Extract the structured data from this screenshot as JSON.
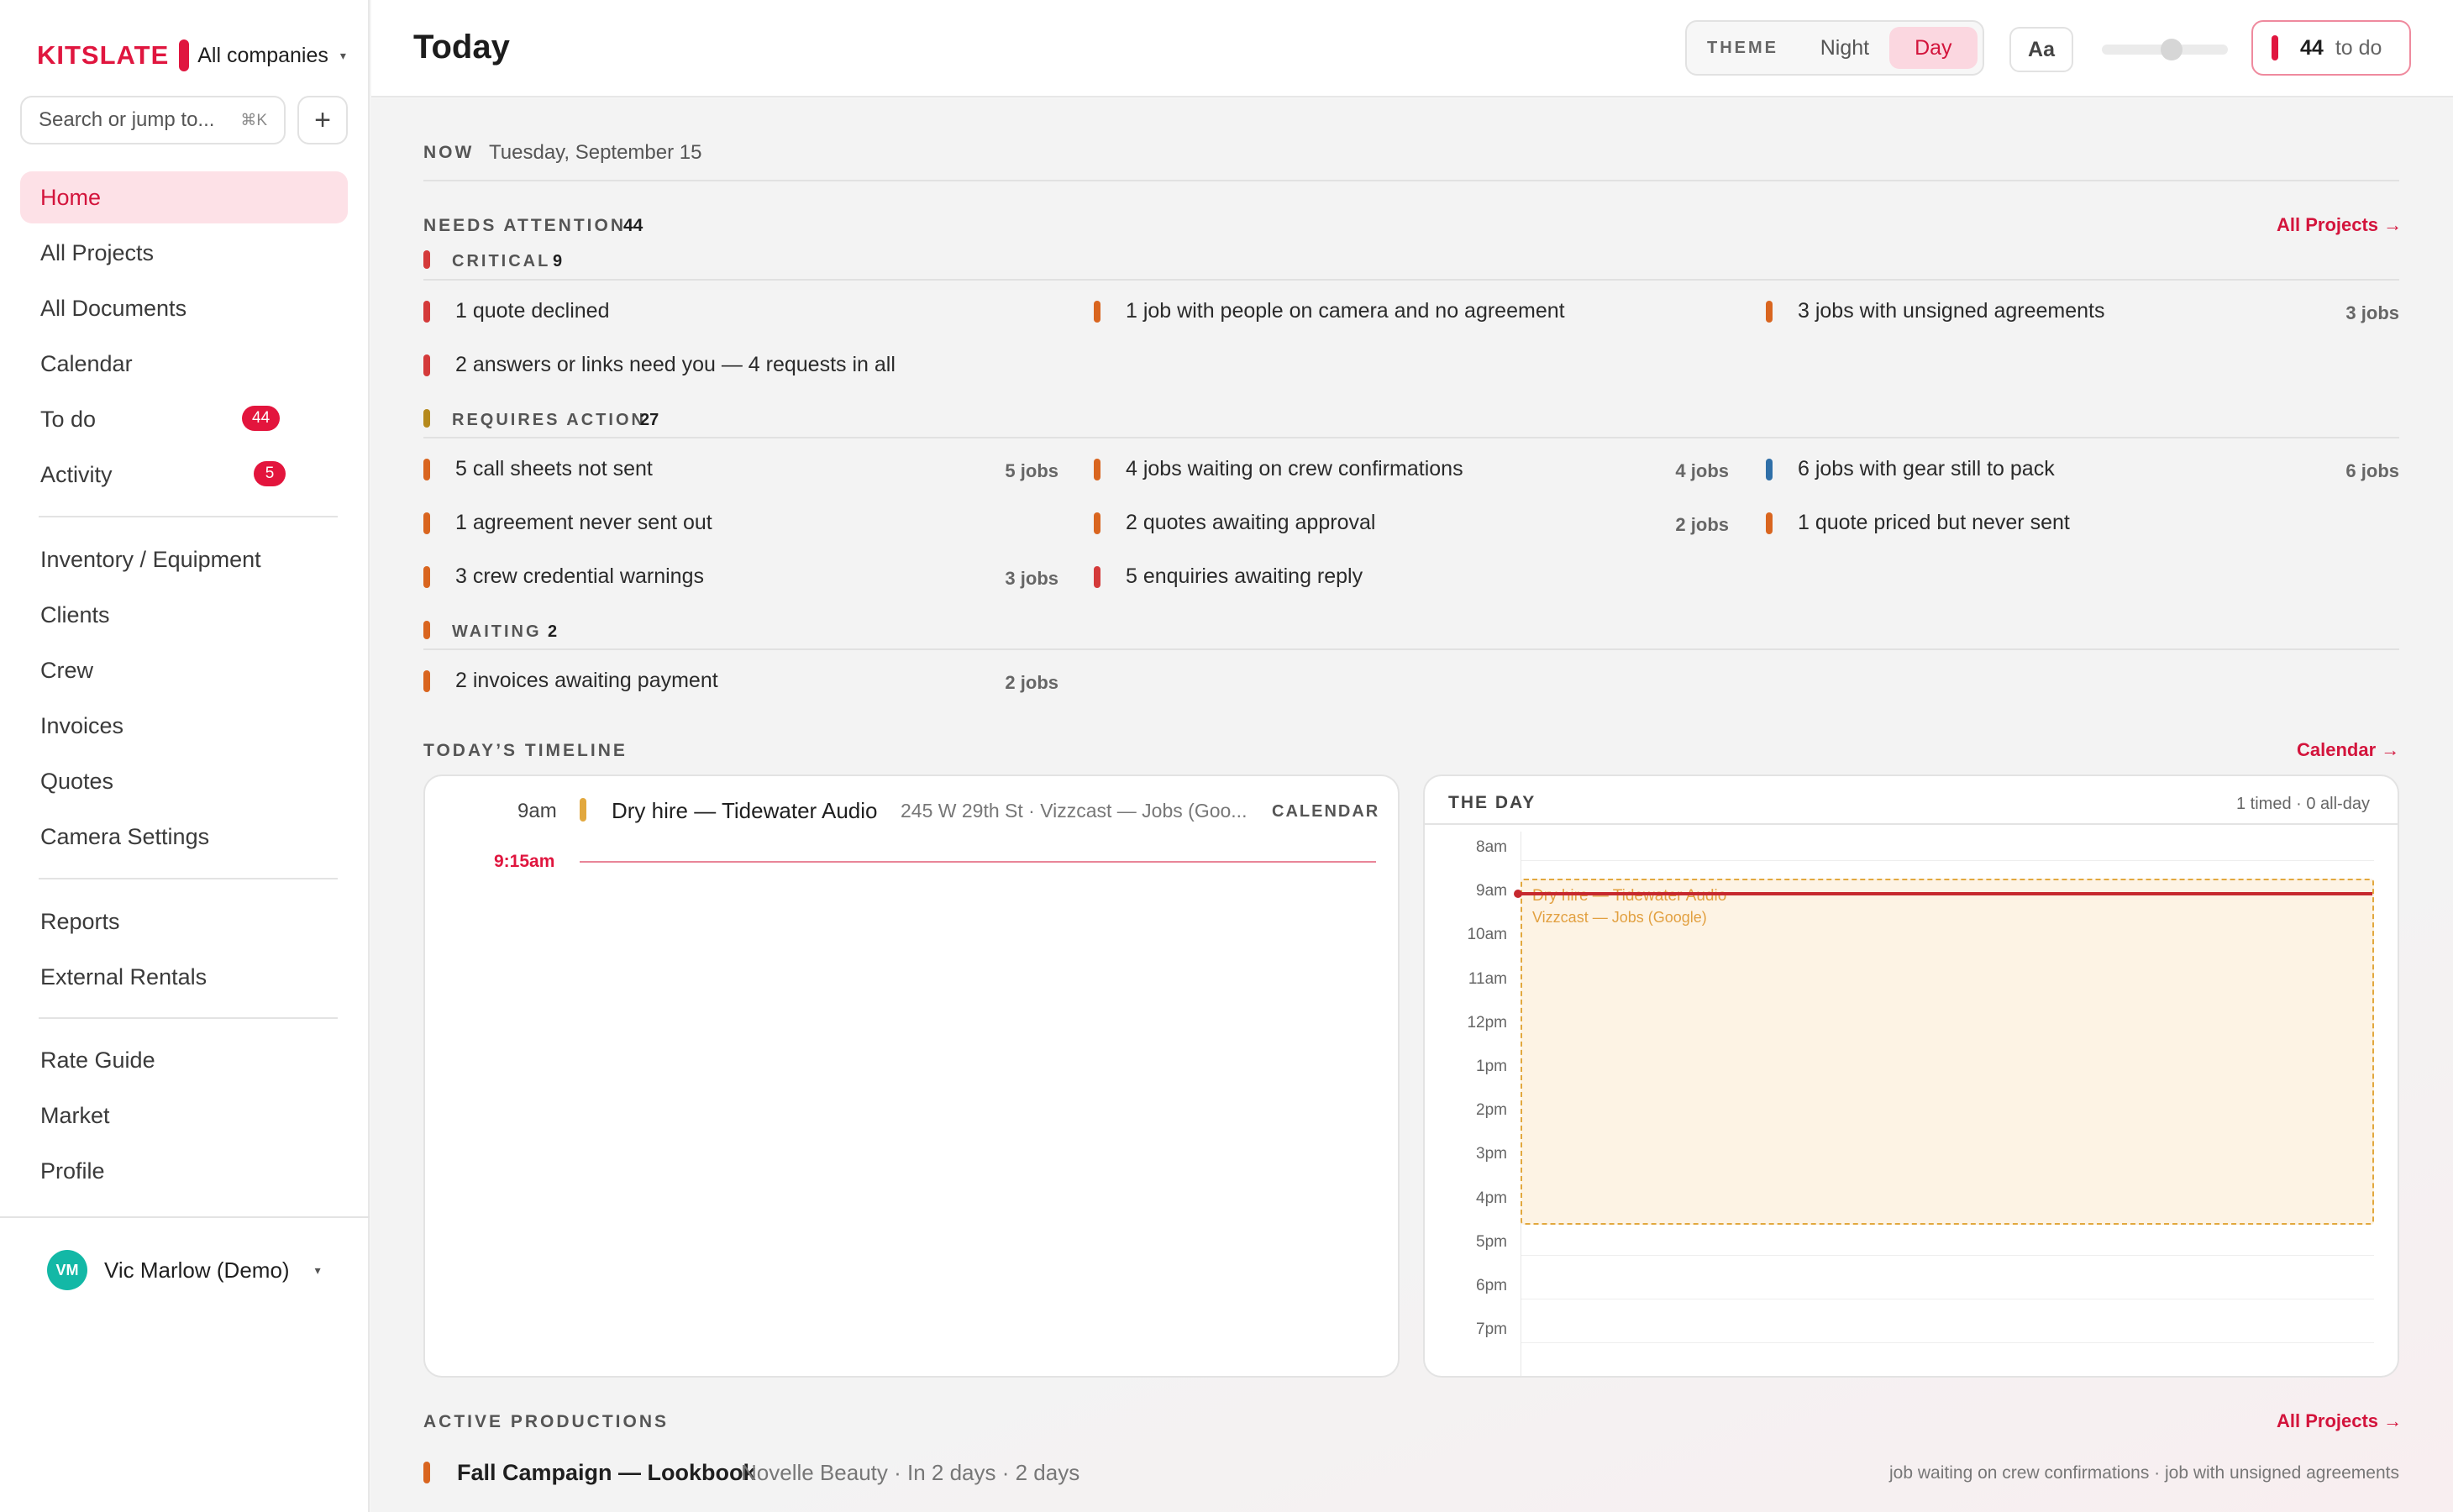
{
  "brand": {
    "name": "KITSLATE",
    "company": "All companies",
    "caret": "▾"
  },
  "search": {
    "placeholder": "Search or jump to...",
    "shortcut": "⌘K",
    "add": "+"
  },
  "sidebar": {
    "items": [
      {
        "label": "Home"
      },
      {
        "label": "All Projects"
      },
      {
        "label": "All Documents"
      },
      {
        "label": "Calendar"
      },
      {
        "label": "To do",
        "badge": "44"
      },
      {
        "label": "Activity",
        "badge": "5"
      },
      {
        "label": "Inventory / Equipment"
      },
      {
        "label": "Clients"
      },
      {
        "label": "Crew"
      },
      {
        "label": "Invoices"
      },
      {
        "label": "Quotes"
      },
      {
        "label": "Camera Settings"
      },
      {
        "label": "Reports"
      },
      {
        "label": "External Rentals"
      },
      {
        "label": "Rate Guide"
      },
      {
        "label": "Market"
      },
      {
        "label": "Profile"
      }
    ],
    "user": {
      "initials": "VM",
      "name": "Vic Marlow (Demo)",
      "caret": "▾"
    }
  },
  "header": {
    "title": "Today",
    "theme_label": "THEME",
    "theme_night": "Night",
    "theme_day": "Day",
    "font_button": "Aa",
    "text_size_level": 0.55,
    "todo_count": "44",
    "todo_label": "to do"
  },
  "now": {
    "label": "NOW",
    "date": "Tuesday, September 15"
  },
  "attention": {
    "label": "NEEDS ATTENTION",
    "count": "44",
    "link": "All Projects →",
    "critical": {
      "label": "CRITICAL",
      "count": "9",
      "items": [
        {
          "text": "1 quote declined",
          "jobs": ""
        },
        {
          "text": "1 job with people on camera and no agreement",
          "jobs": ""
        },
        {
          "text": "3 jobs with unsigned agreements",
          "jobs": "3 jobs"
        },
        {
          "text": "2 answers or links need you — 4 requests in all",
          "jobs": ""
        }
      ]
    },
    "requires": {
      "label": "REQUIRES ACTION",
      "count": "27",
      "items": [
        {
          "text": "5 call sheets not sent",
          "jobs": "5 jobs"
        },
        {
          "text": "4 jobs waiting on crew confirmations",
          "jobs": "4 jobs"
        },
        {
          "text": "6 jobs with gear still to pack",
          "jobs": "6 jobs"
        },
        {
          "text": "1 agreement never sent out",
          "jobs": ""
        },
        {
          "text": "2 quotes awaiting approval",
          "jobs": "2 jobs"
        },
        {
          "text": "1 quote priced but never sent",
          "jobs": ""
        },
        {
          "text": "3 crew credential warnings",
          "jobs": "3 jobs"
        },
        {
          "text": "5 enquiries awaiting reply",
          "jobs": ""
        }
      ]
    },
    "waiting": {
      "label": "WAITING",
      "count": "2",
      "items": [
        {
          "text": "2 invoices awaiting payment",
          "jobs": "2 jobs"
        }
      ]
    }
  },
  "timeline": {
    "label": "TODAY’S TIMELINE",
    "link": "Calendar →",
    "event": {
      "time": "9am",
      "title": "Dry hire — Tidewater Audio",
      "meta": "245 W 29th St · Vizzcast — Jobs (Goo...",
      "tag": "CALENDAR"
    },
    "now_time": "9:15am"
  },
  "day": {
    "title": "THE DAY",
    "summary": "1 timed · 0 all-day",
    "hours": [
      "8am",
      "9am",
      "10am",
      "11am",
      "12pm",
      "1pm",
      "2pm",
      "3pm",
      "4pm",
      "5pm",
      "6pm",
      "7pm"
    ],
    "event_title": "Dry hire — Tidewater Audio",
    "event_sub": "Vizzcast — Jobs (Google)"
  },
  "productions": {
    "label": "ACTIVE PRODUCTIONS",
    "link": "All Projects →",
    "items": [
      {
        "title": "Fall Campaign — Lookbook",
        "meta": "Novelle Beauty · In 2 days · 2 days",
        "flags": "job waiting on crew confirmations · job with unsigned agreements"
      }
    ]
  },
  "colors": {
    "accent": "#e0163f",
    "critical": "#d43a3a",
    "warning": "#d9651f",
    "amber": "#b5891c",
    "info": "#2f6fa8",
    "event": "#e2a83e"
  }
}
